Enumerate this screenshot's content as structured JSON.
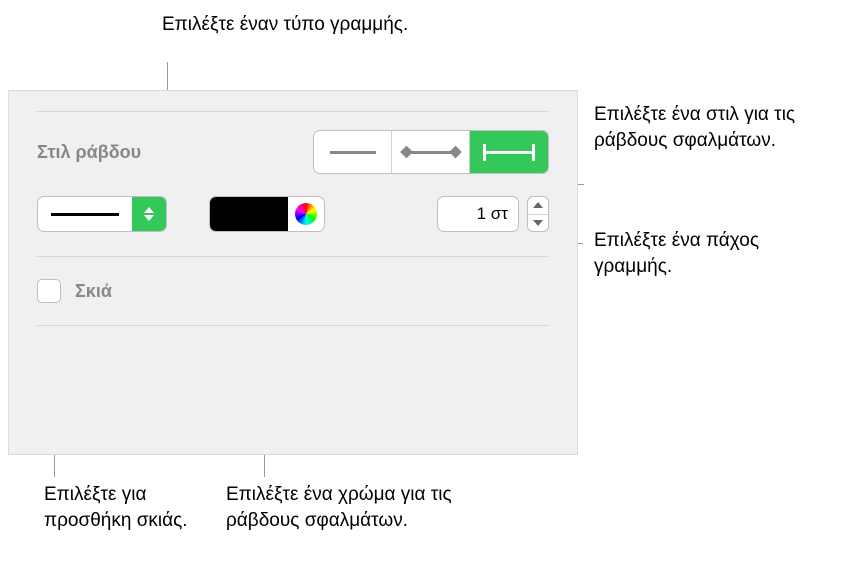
{
  "annotations": {
    "line_type": "Επιλέξτε έναν τύπο γραμμής.",
    "bar_style": "Επιλέξτε ένα στιλ για τις ράβδους σφαλμάτων.",
    "line_width": "Επιλέξτε ένα πάχος γραμμής.",
    "shadow": "Επιλέξτε για προσθήκη σκιάς.",
    "color": "Επιλέξτε ένα χρώμα για τις ράβδους σφαλμάτων."
  },
  "panel": {
    "section_label": "Στιλ ράβδου",
    "segmented": {
      "options": [
        "line",
        "bar-diamond",
        "bar-caps"
      ],
      "selected_index": 2
    },
    "line_type": {
      "value": "solid"
    },
    "color": {
      "hex": "#000000"
    },
    "width": {
      "display": "1 στ"
    },
    "shadow": {
      "label": "Σκιά",
      "checked": false
    }
  }
}
